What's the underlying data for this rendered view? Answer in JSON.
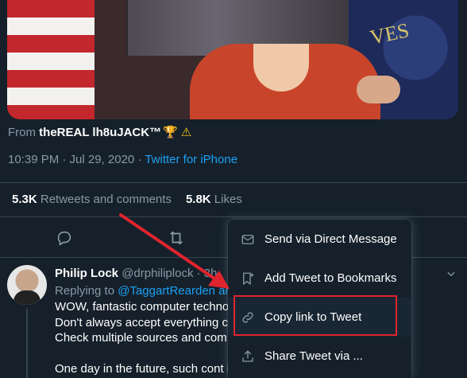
{
  "tweet": {
    "from_prefix": "From",
    "from_name": "theREAL lh8uJACK™",
    "timestamp": "10:39 PM · Jul 29, 2020 · ",
    "source": "Twitter for iPhone",
    "retweets_count": "5.3K",
    "retweets_label": "Retweets and comments",
    "likes_count": "5.8K",
    "likes_label": "Likes"
  },
  "actions": {
    "icons": [
      "reply-icon",
      "retweet-icon",
      "like-icon",
      "share-icon"
    ]
  },
  "reply": {
    "name": "Philip Lock",
    "handle": "@drphilipl",
    "handle_suffix": "ock · 3h",
    "replying_prefix": "Replying to ",
    "replying_to": "@TaggartRearden an",
    "body": "WOW, fantastic computer techno\nDon't always accept everything c\nCheck multiple sources and com\n\nOne day in the future, such cont                                              ike the"
  },
  "menu": {
    "items": [
      {
        "label": "Send via Direct Message",
        "icon": "mail-icon"
      },
      {
        "label": "Add Tweet to Bookmarks",
        "icon": "bookmark-icon"
      },
      {
        "label": "Copy link to Tweet",
        "icon": "link-icon"
      },
      {
        "label": "Share Tweet via ...",
        "icon": "upload-icon"
      }
    ]
  },
  "colors": {
    "background": "#15202b",
    "secondary_text": "#8899a6",
    "accent": "#1da1f2",
    "annotation": "#e0242e"
  }
}
